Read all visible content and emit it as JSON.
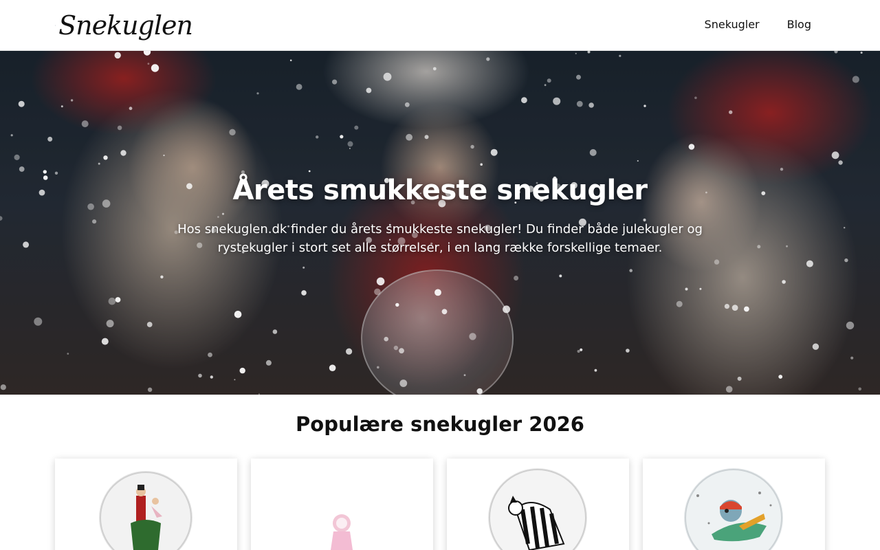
{
  "header": {
    "logo_text": "Snekuglen",
    "nav": [
      {
        "label": "Snekugler"
      },
      {
        "label": "Blog"
      }
    ]
  },
  "hero": {
    "title": "Årets smukkeste snekugler",
    "subtitle": "Hos snekuglen.dk finder du årets smukkeste snekugler! Du finder både julekugler og rystekugler i stort set alle størrelser, i en lang række forskellige temaer."
  },
  "popular": {
    "title": "Populære snekugler 2026",
    "products": [
      {
        "image": "nutcracker-ballerina-snow-globe"
      },
      {
        "image": "pink-figure-snow-globe"
      },
      {
        "image": "zebra-snow-globe"
      },
      {
        "image": "airplane-pilot-snow-globe"
      }
    ]
  },
  "colors": {
    "text": "#111111",
    "background": "#ffffff",
    "hero_text": "#ffffff"
  }
}
